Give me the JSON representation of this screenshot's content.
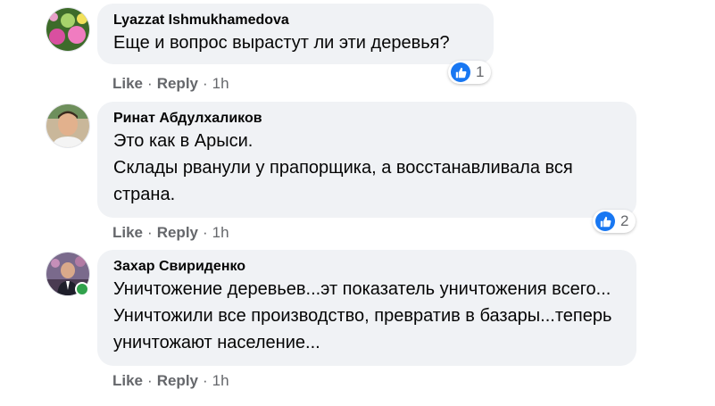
{
  "comments": [
    {
      "author": "Lyazzat Ishmukhamedova",
      "text": "Еще и вопрос вырастут ли эти деревья?",
      "reactions": 1,
      "like": "Like",
      "reply": "Reply",
      "time": "1h",
      "sep": "·"
    },
    {
      "author": "Ринат Абдулхаликов",
      "text": "Это как в Арыси.\nСклады рванули у прапорщика, а восстанавливала вся страна.",
      "reactions": 2,
      "like": "Like",
      "reply": "Reply",
      "time": "1h",
      "sep": "·"
    },
    {
      "author": "Захар Свириденко",
      "text": "Уничтожение деревьев...эт показатель уничтожения всего... Уничтожили все производство, превратив в базары...теперь уничтожают население...",
      "online": true,
      "like": "Like",
      "reply": "Reply",
      "time": "1h",
      "sep": "·"
    }
  ],
  "colors": {
    "bubble": "#f0f2f5",
    "like_blue": "#1877f2",
    "meta_gray": "#65676b",
    "online_green": "#31a24c"
  }
}
